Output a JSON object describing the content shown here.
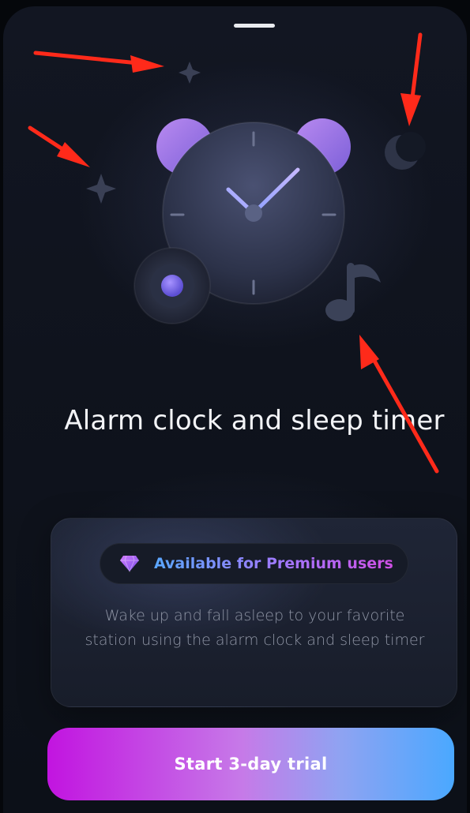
{
  "sheet": {
    "title": "Alarm clock and sleep timer"
  },
  "premium": {
    "badge_label": "Available for Premium users",
    "description": "Wake up and fall asleep to your favorite station using the alarm clock and sleep timer"
  },
  "cta": {
    "label": "Start 3-day trial"
  },
  "illustration": {
    "icons": [
      "alarm-clock-icon",
      "sparkle-icon",
      "crescent-moon-icon",
      "music-note-icon",
      "record-disc-icon"
    ]
  },
  "colors": {
    "accent_pink": "#c214e0",
    "accent_blue": "#4aa8ff",
    "clock_bell_purple": "#a07be8",
    "annotation_red": "#ff2a1a"
  }
}
